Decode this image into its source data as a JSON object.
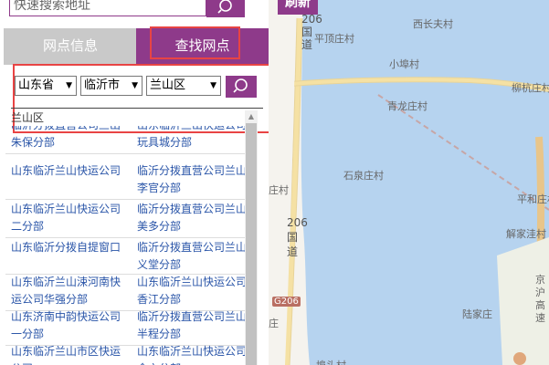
{
  "search": {
    "placeholder": "快速搜索地址"
  },
  "tabs": [
    {
      "label": "网点信息"
    },
    {
      "label": "查找网点"
    }
  ],
  "filter": {
    "province": "山东省",
    "city": "临沂市",
    "district": "兰山区"
  },
  "list": {
    "header": "兰山区",
    "rows": [
      [
        "临沂分拨直营公司兰山朱保分部",
        "山东临沂兰山快运公司玩具城分部"
      ],
      [
        "山东临沂兰山快运公司",
        "临沂分拨直营公司兰山李官分部"
      ],
      [
        "山东临沂兰山快运公司二分部",
        "临沂分拨直营公司兰山美多分部"
      ],
      [
        "山东临沂分拨自提窗口",
        "临沂分拨直营公司兰山义堂分部"
      ],
      [
        "山东临沂兰山涑河南快运公司华强分部",
        "山东临沂兰山快运公司香江分部"
      ],
      [
        "山东济南中韵快运公司一分部",
        "临沂分拨直营公司兰山半程分部"
      ],
      [
        "山东临沂兰山市区快运公司",
        "山东临沂兰山快运公司金六分部"
      ]
    ]
  },
  "map": {
    "refresh_label": "刷新",
    "labels": [
      "平顶庄村",
      "西长夫村",
      "小埠村",
      "柳杭庄村",
      "青龙庄村",
      "石泉庄村",
      "平和庄村",
      "庄村",
      "解家洼村",
      "陆家庄",
      "埠头村",
      "京沪高速"
    ],
    "road_vertical": "206国道",
    "road_vertical_2": "206国道",
    "road_badge": "G206",
    "fragment_left": "庄",
    "water_color": "#b6d3ef",
    "road_color": "#f5e1a4"
  },
  "colors": {
    "accent": "#8e3a8a",
    "highlight_box": "#e84444",
    "link": "#2a55a8"
  }
}
